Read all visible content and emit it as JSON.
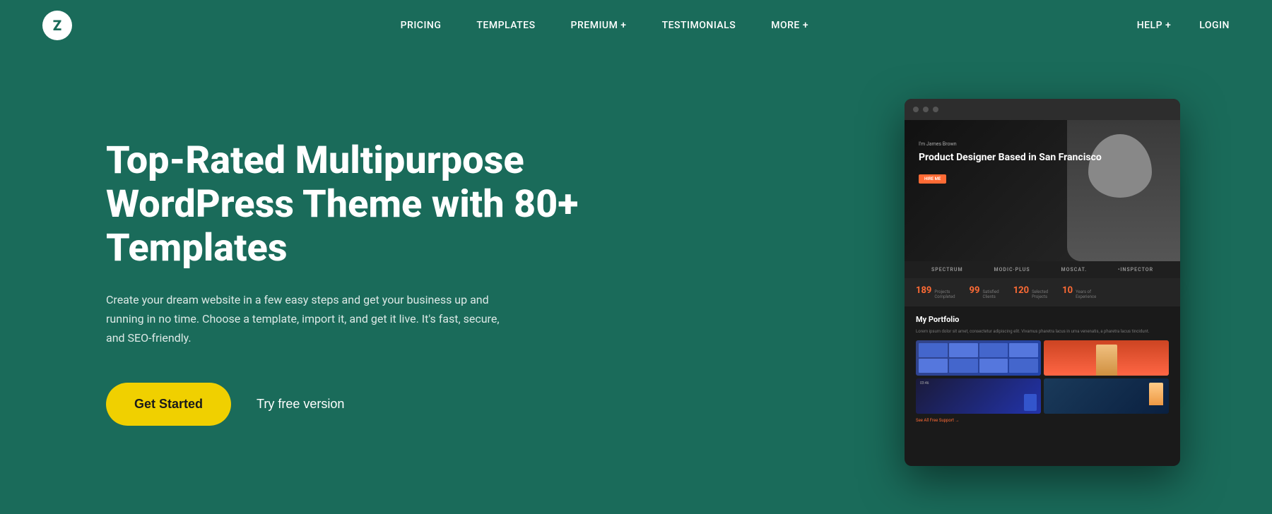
{
  "nav": {
    "logo_text": "Z",
    "items": [
      {
        "label": "PRICING",
        "id": "pricing"
      },
      {
        "label": "TEMPLATES",
        "id": "templates"
      },
      {
        "label": "PREMIUM +",
        "id": "premium"
      },
      {
        "label": "TESTIMONIALS",
        "id": "testimonials"
      },
      {
        "label": "MORE +",
        "id": "more"
      }
    ],
    "right_items": [
      {
        "label": "HELP +",
        "id": "help"
      },
      {
        "label": "LOGIN",
        "id": "login"
      }
    ]
  },
  "hero": {
    "title": "Top-Rated Multipurpose WordPress Theme with 80+ Templates",
    "subtitle": "Create your dream website in a few easy steps and get your business up and running in no time. Choose a template, import it, and get it live. It's fast, secure, and SEO-friendly.",
    "cta_primary": "Get Started",
    "cta_secondary": "Try free version"
  },
  "portfolio_mockup": {
    "label": "I'm James Brown",
    "heading": "Product Designer Based in San Francisco",
    "cta": "HIRE ME",
    "partners": [
      "SPECTRUM",
      "MODIC·Plus",
      "MOSCAT.",
      "•Inspector"
    ],
    "stats": [
      {
        "num": "189",
        "label": "Projects\nCompleted"
      },
      {
        "num": "99",
        "label": "Satisfied\nClients"
      },
      {
        "num": "120",
        "label": "Selected\nProjects"
      },
      {
        "num": "10",
        "label": "Years of\nExperience"
      }
    ],
    "portfolio_title": "My Portfolio",
    "portfolio_link": "See All Free Support →"
  },
  "colors": {
    "bg": "#1a6b5a",
    "btn_primary": "#f0d000",
    "accent_orange": "#ff6b35",
    "dark": "#1a1a1a"
  }
}
